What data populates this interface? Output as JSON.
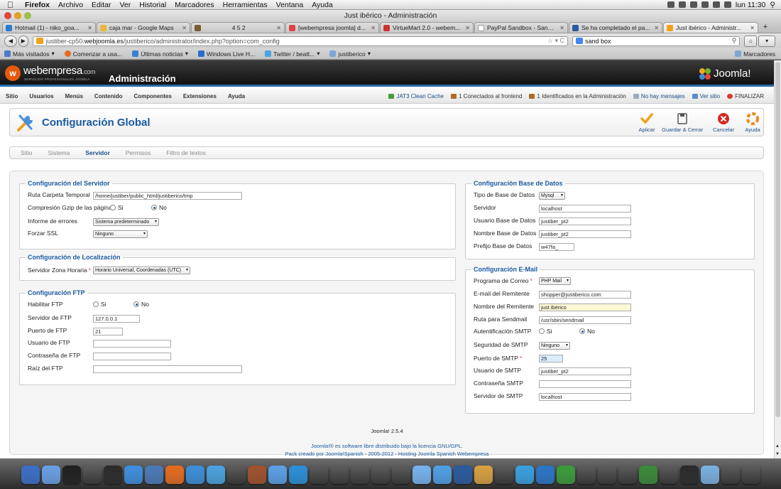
{
  "menubar": {
    "app": "Firefox",
    "items": [
      "Archivo",
      "Editar",
      "Ver",
      "Historial",
      "Marcadores",
      "Herramientas",
      "Ventana",
      "Ayuda"
    ],
    "clock": "lun 11:30"
  },
  "window": {
    "title": "Just ibérico - Administración"
  },
  "tabs": [
    {
      "label": "Hotmail (1) - niko_goa...",
      "color": "#2b7ad0",
      "active": false
    },
    {
      "label": "caja mar - Google Maps",
      "color": "#e9b83a",
      "active": false
    },
    {
      "label": "4 5 2",
      "color": "#7a5c2e",
      "active": false
    },
    {
      "label": "[webempresa joomla] d...",
      "color": "#d44",
      "active": false
    },
    {
      "label": "VirtueMart 2.0 - webem...",
      "color": "#c33",
      "active": false
    },
    {
      "label": "PayPal Sandbox - Sandb...",
      "color": "#fff",
      "active": false
    },
    {
      "label": "Se ha completado el pa...",
      "color": "#2a5aa0",
      "active": false
    },
    {
      "label": "Just ibérico - Administr...",
      "color": "#f3a11c",
      "active": true
    }
  ],
  "nav": {
    "url_prefix": "justiber-cp50.",
    "url_domain": "webjoomla.es",
    "url_rest": "/justiberico/administrator/index.php?option=com_config",
    "search_value": "sand box"
  },
  "bookmarks": {
    "items": [
      "Más visitados",
      "Comenzar a usa...",
      "Últimas noticias",
      "Windows Live H...",
      "Twitter / beatt...",
      "justiberico"
    ],
    "folder": "Marcadores"
  },
  "joomla": {
    "brand": "webempresa",
    "brand_suffix": ".com",
    "brand_tag": "SERVICIOS PROFESIONALES JOOMLA",
    "section": "Administración",
    "joomla_logo": "Joomla!",
    "menu": [
      "Sitio",
      "Usuarios",
      "Menús",
      "Contenido",
      "Componentes",
      "Extensiones",
      "Ayuda"
    ],
    "status": [
      "JAT3 Clean Cache",
      "1 Conectados al frontend",
      "1 Identificados en la Administración",
      "No hay mensajes",
      "Ver sitio",
      "FINALIZAR"
    ],
    "page_title": "Configuración Global",
    "toolbar": {
      "apply": "Aplicar",
      "save_close": "Guardar & Cerrar",
      "cancel": "Cancelar",
      "help": "Ayuda"
    },
    "subtabs": [
      "Sitio",
      "Sistema",
      "Servidor",
      "Permisos",
      "Filtro de textos"
    ],
    "active_subtab": "Servidor",
    "yes": "Si",
    "no": "No"
  },
  "server": {
    "legend": "Configuración del Servidor",
    "tmp_label": "Ruta Carpeta Temporal",
    "tmp_value": "/home/justiber/public_html/justiberico/tmp",
    "gzip_label": "Compresión Gzip de las páginas",
    "errors_label": "Informe de errores",
    "errors_value": "Sistema predeterminado",
    "ssl_label": "Forzar SSL",
    "ssl_value": "Ninguno"
  },
  "locale": {
    "legend": "Configuración de Localización",
    "tz_label": "Servidor Zona Horaria",
    "tz_value": "Horario Universal, Coordenadas (UTC)"
  },
  "ftp": {
    "legend": "Configuración FTP",
    "enable_label": "Habilitar FTP",
    "server_label": "Servidor de FTP",
    "server_value": "127.0.0.1",
    "port_label": "Puerto de FTP",
    "port_value": "21",
    "user_label": "Usuario de FTP",
    "user_value": "",
    "pass_label": "Contraseña de FTP",
    "pass_value": "",
    "root_label": "Raíz del FTP",
    "root_value": ""
  },
  "db": {
    "legend": "Configuración Base de Datos",
    "type_label": "Tipo de Base de Datos",
    "type_value": "Mysql",
    "server_label": "Servidor",
    "server_value": "localhost",
    "user_label": "Usuario Base de Datos",
    "user_value": "justiber_pt2",
    "name_label": "Nombre Base de Datos",
    "name_value": "justiber_pt2",
    "prefix_label": "Prefijo Base de Datos",
    "prefix_value": "w47fa_"
  },
  "mail": {
    "legend": "Configuración E-Mail",
    "mailer_label": "Programa de Correo",
    "mailer_value": "PHP Mail",
    "from_label": "E-mail del Remitente",
    "from_value": "shopper@justiberico.com",
    "fromname_label": "Nombre del Remitente",
    "fromname_value": "just ibérico",
    "sendmail_label": "Ruta para Sendmail",
    "sendmail_value": "/usr/sbin/sendmail",
    "smtpauth_label": "Autentificación SMTP",
    "smtpsecure_label": "Seguridad de SMTP",
    "smtpsecure_value": "Ninguno",
    "smtpport_label": "Puerto de SMTP",
    "smtpport_value": "25",
    "smtpuser_label": "Usuario de SMTP",
    "smtpuser_value": "justiber_pt2",
    "smtppass_label": "Contraseña SMTP",
    "smtppass_value": "",
    "smtphost_label": "Servidor de SMTP",
    "smtphost_value": "localhost"
  },
  "footer": {
    "version": "Joomla! 2.5.4",
    "license": "Joomla!® es software libre distribuido bajo la licencia GNU/GPL.",
    "pack": "Pack creado por Joomla!Spanish - 2005-2012 - Hosting Joomla Spanish Webempresa"
  },
  "dock_colors": [
    "#3b6fc7",
    "#6aa0e6",
    "#1f1f1f",
    "#888",
    "#2a2a2a",
    "#3d8fe0",
    "#4b79b8",
    "#e56b1f",
    "#3b8fd9",
    "#49a2e0",
    "#eee",
    "#a0522d",
    "#5aa0e8",
    "#2a8fd8",
    "#222",
    "#aaa",
    "#ddd",
    "#c04",
    "#444",
    "#76b3f0",
    "#4ea0e6",
    "#2b5aa0",
    "#d8a040",
    "#888",
    "#38a0e0",
    "#2a75c8",
    "#3a9b3a",
    "#555",
    "#444",
    "#999",
    "#3a8a3a",
    "#ccc",
    "#2a2a2a",
    "#7ab0e0",
    "#ddd",
    "#666"
  ]
}
